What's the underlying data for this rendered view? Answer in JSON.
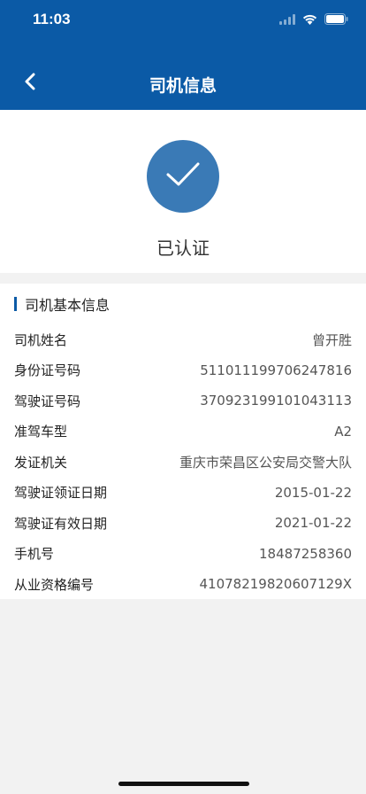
{
  "status_bar": {
    "time": "11:03"
  },
  "nav": {
    "title": "司机信息"
  },
  "verification": {
    "status_label": "已认证"
  },
  "section": {
    "title": "司机基本信息"
  },
  "fields": [
    {
      "label": "司机姓名",
      "value": "曾开胜"
    },
    {
      "label": "身份证号码",
      "value": "511011199706247816"
    },
    {
      "label": "驾驶证号码",
      "value": "370923199101043113"
    },
    {
      "label": "准驾车型",
      "value": "A2"
    },
    {
      "label": "发证机关",
      "value": "重庆市荣昌区公安局交警大队"
    },
    {
      "label": "驾驶证领证日期",
      "value": "2015-01-22"
    },
    {
      "label": "驾驶证有效日期",
      "value": "2021-01-22"
    },
    {
      "label": "手机号",
      "value": "18487258360"
    },
    {
      "label": "从业资格编号",
      "value": "41078219820607129X"
    }
  ],
  "colors": {
    "header_bg": "#0b5aa6",
    "check_circle": "#3a7ab6",
    "section_bar": "#0b5aa6"
  },
  "icons": [
    "back-chevron-icon",
    "check-icon",
    "wifi-icon",
    "battery-icon"
  ]
}
